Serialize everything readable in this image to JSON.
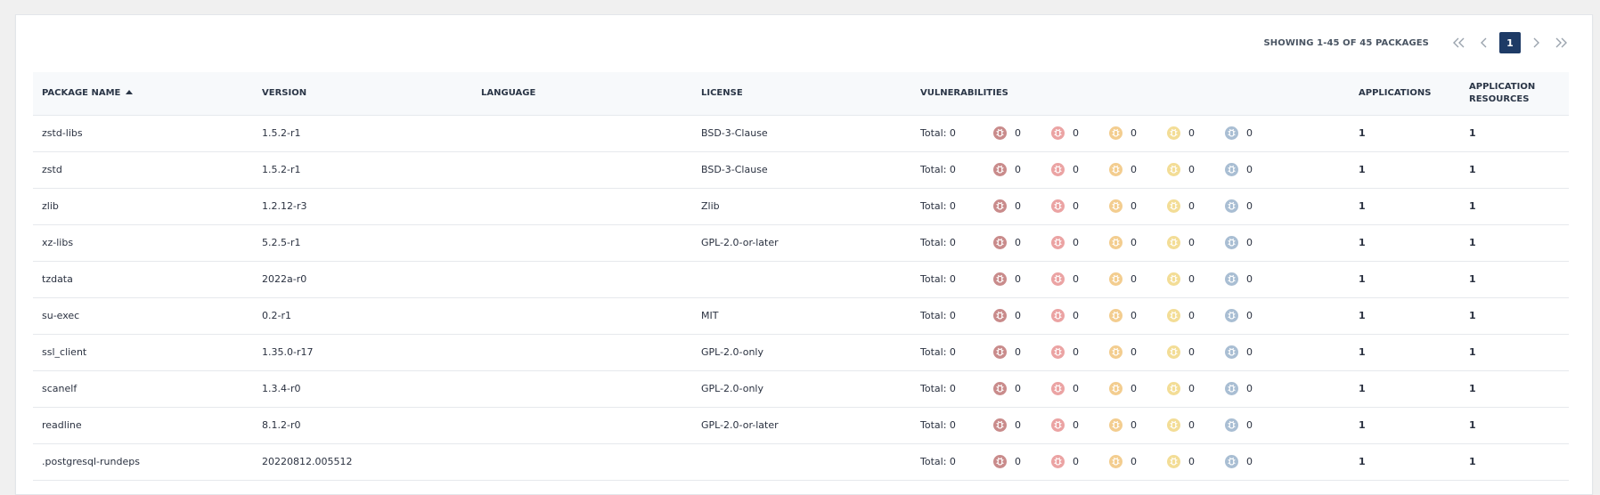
{
  "pagination": {
    "showing_text": "SHOWING 1-45 OF 45 PACKAGES",
    "current_page": "1"
  },
  "columns": {
    "package_name": "PACKAGE NAME",
    "version": "VERSION",
    "language": "LANGUAGE",
    "license": "LICENSE",
    "vulnerabilities": "VULNERABILITIES",
    "applications": "APPLICATIONS",
    "application_resources_line1": "APPLICATION",
    "application_resources_line2": "RESOURCES"
  },
  "severity_levels": [
    {
      "name": "critical",
      "color": "#c98b8b"
    },
    {
      "name": "high",
      "color": "#eba3a3"
    },
    {
      "name": "medium",
      "color": "#f3cd8f"
    },
    {
      "name": "low",
      "color": "#f3dd96"
    },
    {
      "name": "unknown",
      "color": "#a9bed3"
    }
  ],
  "rows": [
    {
      "name": "zstd-libs",
      "version": "1.5.2-r1",
      "language": "",
      "license": "BSD-3-Clause",
      "total": "Total: 0",
      "critical": "0",
      "high": "0",
      "medium": "0",
      "low": "0",
      "unknown": "0",
      "applications": "1",
      "resources": "1"
    },
    {
      "name": "zstd",
      "version": "1.5.2-r1",
      "language": "",
      "license": "BSD-3-Clause",
      "total": "Total: 0",
      "critical": "0",
      "high": "0",
      "medium": "0",
      "low": "0",
      "unknown": "0",
      "applications": "1",
      "resources": "1"
    },
    {
      "name": "zlib",
      "version": "1.2.12-r3",
      "language": "",
      "license": "Zlib",
      "total": "Total: 0",
      "critical": "0",
      "high": "0",
      "medium": "0",
      "low": "0",
      "unknown": "0",
      "applications": "1",
      "resources": "1"
    },
    {
      "name": "xz-libs",
      "version": "5.2.5-r1",
      "language": "",
      "license": "GPL-2.0-or-later",
      "total": "Total: 0",
      "critical": "0",
      "high": "0",
      "medium": "0",
      "low": "0",
      "unknown": "0",
      "applications": "1",
      "resources": "1"
    },
    {
      "name": "tzdata",
      "version": "2022a-r0",
      "language": "",
      "license": "",
      "total": "Total: 0",
      "critical": "0",
      "high": "0",
      "medium": "0",
      "low": "0",
      "unknown": "0",
      "applications": "1",
      "resources": "1"
    },
    {
      "name": "su-exec",
      "version": "0.2-r1",
      "language": "",
      "license": "MIT",
      "total": "Total: 0",
      "critical": "0",
      "high": "0",
      "medium": "0",
      "low": "0",
      "unknown": "0",
      "applications": "1",
      "resources": "1"
    },
    {
      "name": "ssl_client",
      "version": "1.35.0-r17",
      "language": "",
      "license": "GPL-2.0-only",
      "total": "Total: 0",
      "critical": "0",
      "high": "0",
      "medium": "0",
      "low": "0",
      "unknown": "0",
      "applications": "1",
      "resources": "1"
    },
    {
      "name": "scanelf",
      "version": "1.3.4-r0",
      "language": "",
      "license": "GPL-2.0-only",
      "total": "Total: 0",
      "critical": "0",
      "high": "0",
      "medium": "0",
      "low": "0",
      "unknown": "0",
      "applications": "1",
      "resources": "1"
    },
    {
      "name": "readline",
      "version": "8.1.2-r0",
      "language": "",
      "license": "GPL-2.0-or-later",
      "total": "Total: 0",
      "critical": "0",
      "high": "0",
      "medium": "0",
      "low": "0",
      "unknown": "0",
      "applications": "1",
      "resources": "1"
    },
    {
      "name": ".postgresql-rundeps",
      "version": "20220812.005512",
      "language": "",
      "license": "",
      "total": "Total: 0",
      "critical": "0",
      "high": "0",
      "medium": "0",
      "low": "0",
      "unknown": "0",
      "applications": "1",
      "resources": "1"
    }
  ]
}
